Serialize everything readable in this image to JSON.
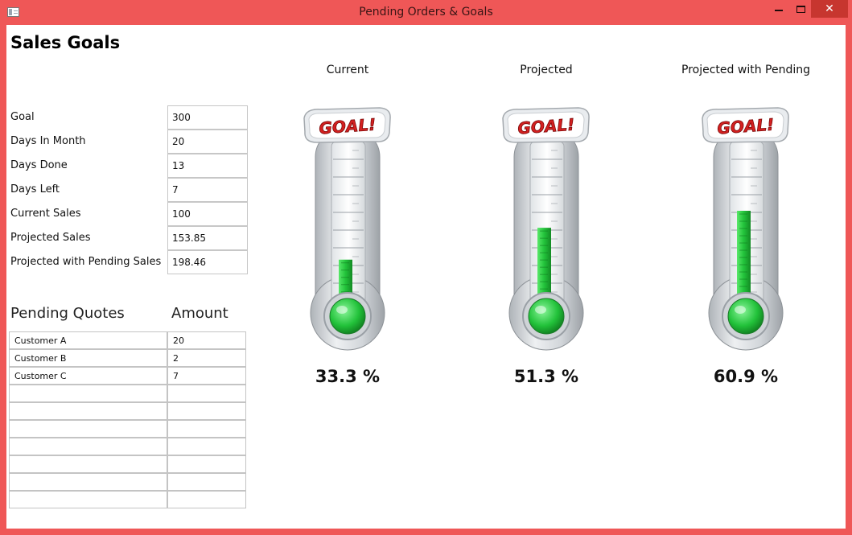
{
  "window": {
    "title": "Pending Orders & Goals",
    "close_glyph": "✕"
  },
  "page": {
    "heading": "Sales Goals"
  },
  "goal_fields": [
    {
      "label": "Goal",
      "value": "300"
    },
    {
      "label": "Days In Month",
      "value": "20"
    },
    {
      "label": "Days Done",
      "value": "13"
    },
    {
      "label": "Days Left",
      "value": "7"
    },
    {
      "label": "Current Sales",
      "value": "100"
    },
    {
      "label": "Projected Sales",
      "value": "153.85"
    },
    {
      "label": "Projected with Pending Sales",
      "value": "198.46"
    }
  ],
  "quotes": {
    "header_name": "Pending Quotes",
    "header_amount": "Amount",
    "rows": [
      {
        "customer": "Customer A",
        "amount": "20"
      },
      {
        "customer": "Customer B",
        "amount": "2"
      },
      {
        "customer": "Customer C",
        "amount": "7"
      },
      {
        "customer": "",
        "amount": ""
      },
      {
        "customer": "",
        "amount": ""
      },
      {
        "customer": "",
        "amount": ""
      },
      {
        "customer": "",
        "amount": ""
      },
      {
        "customer": "",
        "amount": ""
      },
      {
        "customer": "",
        "amount": ""
      },
      {
        "customer": "",
        "amount": ""
      }
    ]
  },
  "gauges": [
    {
      "label": "Current",
      "percent_text": "33.3 %",
      "fill_fraction": 0.333,
      "badge": "GOAL!"
    },
    {
      "label": "Projected",
      "percent_text": "51.3 %",
      "fill_fraction": 0.513,
      "badge": "GOAL!"
    },
    {
      "label": "Projected with Pending",
      "percent_text": "60.9 %",
      "fill_fraction": 0.609,
      "badge": "GOAL!"
    }
  ],
  "colors": {
    "titlebar": "#ef5757",
    "close_button": "#c7362f",
    "fill_green": "#22c23a",
    "badge_red": "#d42020"
  },
  "icons": [
    "app-icon",
    "minimize-icon",
    "maximize-icon",
    "close-icon",
    "goal-thermometer-icon"
  ]
}
